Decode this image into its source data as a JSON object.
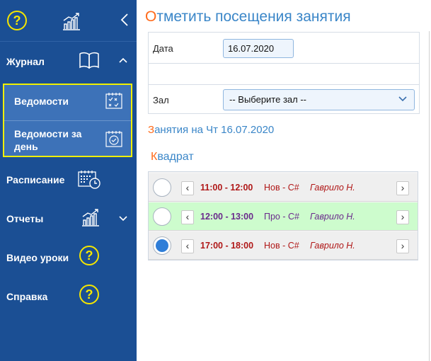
{
  "sidebar": {
    "help_glyph": "?",
    "journal_label": "Журнал",
    "sub_items": [
      {
        "label": "Ведомости"
      },
      {
        "label": "Ведомости за\nдень"
      }
    ],
    "schedule_label": "Расписание",
    "reports_label": "Отчеты",
    "video_label": "Видео уроки",
    "help_label": "Справка",
    "icons": [
      "help-icon",
      "chart-icon",
      "collapse-icon",
      "book-icon",
      "chevron-up-icon",
      "checklist-icon",
      "calendar-check-icon",
      "schedule-calendar-icon",
      "chart-icon",
      "chevron-down-icon"
    ]
  },
  "main": {
    "title_first": "О",
    "title_rest": "тметить посещения занятия",
    "form": {
      "date_label": "Дата",
      "date_value": "16.07.2020",
      "hall_label": "Зал",
      "hall_value": "-- Выберите зал --"
    },
    "lessons_first": "З",
    "lessons_rest": "анятия на Чт 16.07.2020",
    "group_first": "К",
    "group_rest": "вадрат",
    "lessons": [
      {
        "time": "11:00 - 12:00",
        "course": "Нов - C#",
        "teacher": "Гаврило Н.",
        "selected": false,
        "highlight": false
      },
      {
        "time": "12:00 - 13:00",
        "course": "Про - C#",
        "teacher": "Гаврило Н.",
        "selected": false,
        "highlight": true
      },
      {
        "time": "17:00 - 18:00",
        "course": "Нов - C#",
        "teacher": "Гаврило Н.",
        "selected": true,
        "highlight": false
      }
    ],
    "prev_glyph": "‹",
    "next_glyph": "›"
  },
  "colors": {
    "sidebar_bg": "#1b4f94",
    "submenu_bg": "#3d72b8",
    "highlight_border": "#f0f000",
    "accent_orange": "#ff6a1a",
    "title_blue": "#3a86c8",
    "row_active_bg": "#cdfccd",
    "time_red": "#b01818",
    "time_purple": "#6a2a8c"
  }
}
